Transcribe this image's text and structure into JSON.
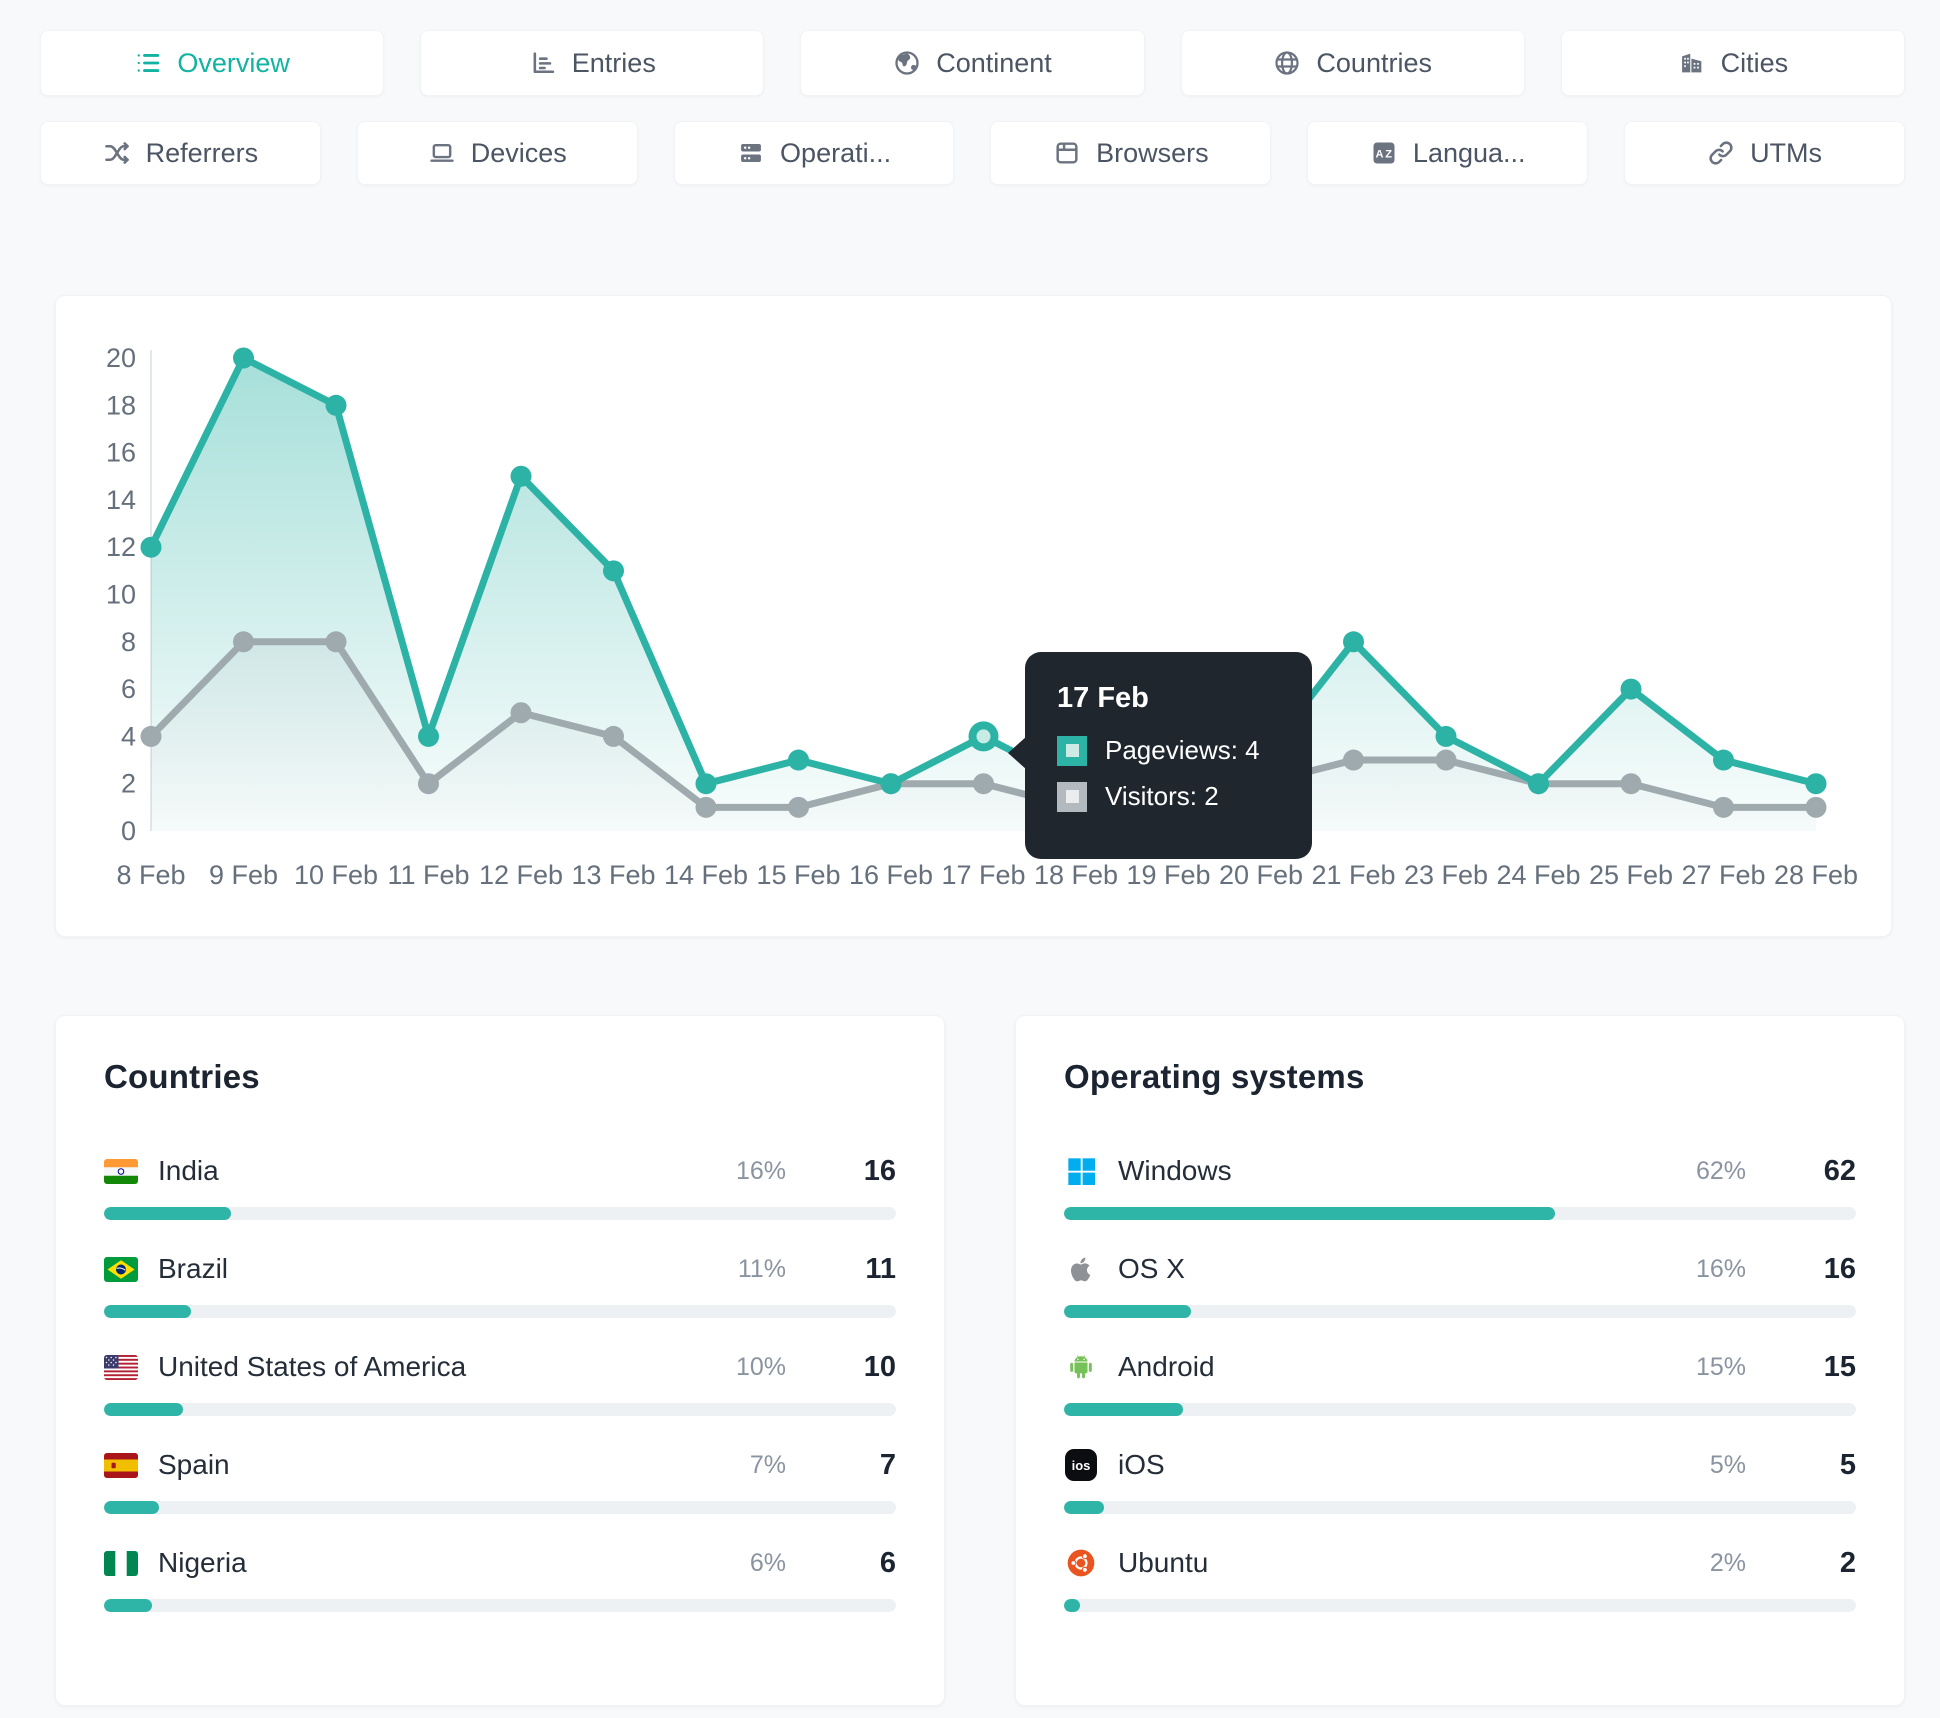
{
  "tabs_row1": [
    {
      "label": "Overview",
      "icon": "list-icon",
      "active": true
    },
    {
      "label": "Entries",
      "icon": "bar-chart-icon",
      "active": false
    },
    {
      "label": "Continent",
      "icon": "continent-icon",
      "active": false
    },
    {
      "label": "Countries",
      "icon": "globe-icon",
      "active": false
    },
    {
      "label": "Cities",
      "icon": "buildings-icon",
      "active": false
    }
  ],
  "tabs_row2": [
    {
      "label": "Referrers",
      "icon": "shuffle-icon",
      "active": false
    },
    {
      "label": "Devices",
      "icon": "laptop-icon",
      "active": false
    },
    {
      "label": "Operati...",
      "icon": "server-icon",
      "active": false
    },
    {
      "label": "Browsers",
      "icon": "browser-icon",
      "active": false
    },
    {
      "label": "Langua...",
      "icon": "translate-icon",
      "active": false
    },
    {
      "label": "UTMs",
      "icon": "link-icon",
      "active": false
    }
  ],
  "chart_data": {
    "type": "area",
    "categories": [
      "8 Feb",
      "9 Feb",
      "10 Feb",
      "11 Feb",
      "12 Feb",
      "13 Feb",
      "14 Feb",
      "15 Feb",
      "16 Feb",
      "17 Feb",
      "18 Feb",
      "19 Feb",
      "20 Feb",
      "21 Feb",
      "23 Feb",
      "24 Feb",
      "25 Feb",
      "27 Feb",
      "28 Feb"
    ],
    "series": [
      {
        "name": "Pageviews",
        "color": "#2cb3a6",
        "values": [
          12,
          20,
          18,
          4,
          15,
          11,
          2,
          3,
          2,
          4,
          2,
          2,
          3,
          8,
          4,
          2,
          6,
          3,
          2
        ]
      },
      {
        "name": "Visitors",
        "color": "#9faaaf",
        "values": [
          4,
          8,
          8,
          2,
          5,
          4,
          1,
          1,
          2,
          2,
          1,
          1,
          2,
          3,
          3,
          2,
          2,
          1,
          1
        ]
      }
    ],
    "ylim": [
      0,
      20
    ],
    "y_ticks": [
      0,
      2,
      4,
      6,
      8,
      10,
      12,
      14,
      16,
      18,
      20
    ],
    "grid": "off",
    "legend_position": "none",
    "highlight": {
      "series_index": 0,
      "index": 9,
      "inner_color": "#c9ebe6"
    }
  },
  "tooltip": {
    "title": "17 Feb",
    "rows": [
      {
        "label": "Pageviews: 4",
        "color": "#2cb3a6",
        "inner": "#cdeae6"
      },
      {
        "label": "Visitors: 2",
        "color": "#b2b9bf",
        "inner": "#eaecee"
      }
    ]
  },
  "countries": {
    "title": "Countries",
    "rows": [
      {
        "name": "India",
        "icon": "india-flag",
        "percent": "16%",
        "percent_value": 16,
        "count": "16"
      },
      {
        "name": "Brazil",
        "icon": "brazil-flag",
        "percent": "11%",
        "percent_value": 11,
        "count": "11"
      },
      {
        "name": "United States of America",
        "icon": "usa-flag",
        "percent": "10%",
        "percent_value": 10,
        "count": "10"
      },
      {
        "name": "Spain",
        "icon": "spain-flag",
        "percent": "7%",
        "percent_value": 7,
        "count": "7"
      },
      {
        "name": "Nigeria",
        "icon": "nigeria-flag",
        "percent": "6%",
        "percent_value": 6,
        "count": "6"
      }
    ]
  },
  "operating_systems": {
    "title": "Operating systems",
    "rows": [
      {
        "name": "Windows",
        "icon": "windows-logo",
        "percent": "62%",
        "percent_value": 62,
        "count": "62"
      },
      {
        "name": "OS X",
        "icon": "apple-logo",
        "percent": "16%",
        "percent_value": 16,
        "count": "16"
      },
      {
        "name": "Android",
        "icon": "android-logo",
        "percent": "15%",
        "percent_value": 15,
        "count": "15"
      },
      {
        "name": "iOS",
        "icon": "ios-logo",
        "badge_text": "ios",
        "percent": "5%",
        "percent_value": 5,
        "count": "5"
      },
      {
        "name": "Ubuntu",
        "icon": "ubuntu-logo",
        "percent": "2%",
        "percent_value": 2,
        "count": "2"
      }
    ]
  }
}
